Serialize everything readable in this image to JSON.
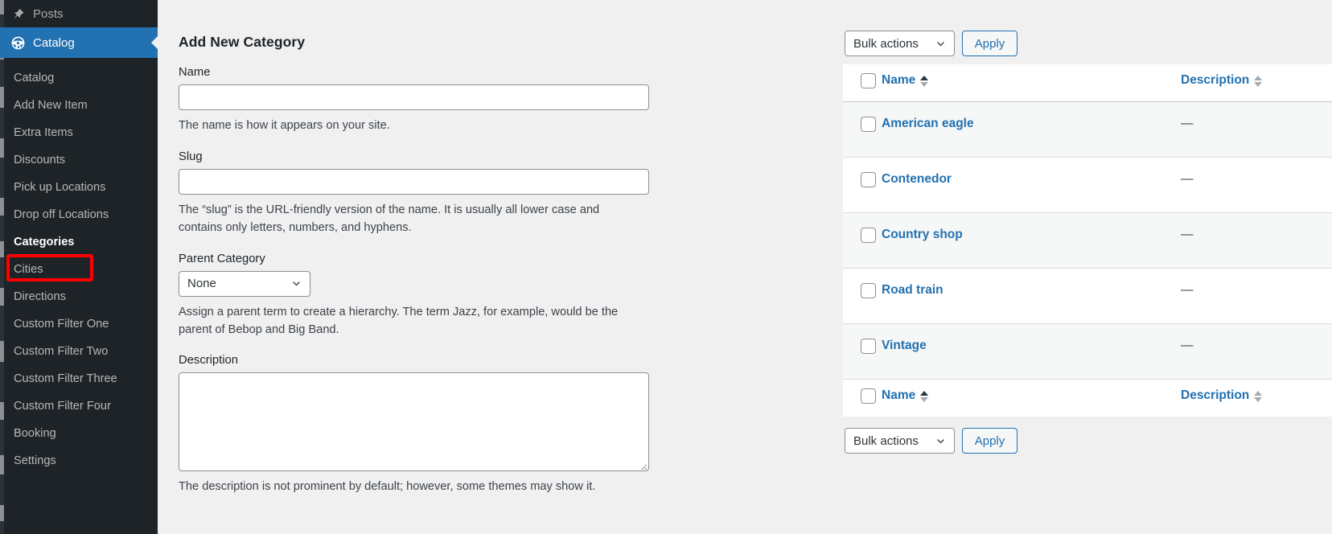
{
  "sidebar": {
    "top_item": {
      "label": "Posts",
      "icon": "pin-icon"
    },
    "current_item": {
      "label": "Catalog",
      "icon": "steering-wheel-icon"
    },
    "submenu": [
      {
        "label": "Catalog",
        "active": false
      },
      {
        "label": "Add New Item",
        "active": false
      },
      {
        "label": "Extra Items",
        "active": false
      },
      {
        "label": "Discounts",
        "active": false
      },
      {
        "label": "Pick up Locations",
        "active": false
      },
      {
        "label": "Drop off Locations",
        "active": false
      },
      {
        "label": "Categories",
        "active": true
      },
      {
        "label": "Cities",
        "active": false
      },
      {
        "label": "Directions",
        "active": false
      },
      {
        "label": "Custom Filter One",
        "active": false
      },
      {
        "label": "Custom Filter Two",
        "active": false
      },
      {
        "label": "Custom Filter Three",
        "active": false
      },
      {
        "label": "Custom Filter Four",
        "active": false
      },
      {
        "label": "Booking",
        "active": false
      },
      {
        "label": "Settings",
        "active": false
      }
    ],
    "highlight_color": "#ff0000",
    "active_bg": "#2271b1",
    "bg": "#1d2327"
  },
  "form": {
    "title": "Add New Category",
    "name": {
      "label": "Name",
      "value": "",
      "placeholder": "",
      "help": "The name is how it appears on your site."
    },
    "slug": {
      "label": "Slug",
      "value": "",
      "placeholder": "",
      "help": "The “slug” is the URL-friendly version of the name. It is usually all lower case and contains only letters, numbers, and hyphens."
    },
    "parent": {
      "label": "Parent Category",
      "selected": "None",
      "options": [
        "None"
      ],
      "help": "Assign a parent term to create a hierarchy. The term Jazz, for example, would be the parent of Bebop and Big Band."
    },
    "description": {
      "label": "Description",
      "value": "",
      "placeholder": "",
      "help": "The description is not prominent by default; however, some themes may show it."
    }
  },
  "table": {
    "bulk_actions_top": {
      "selected": "Bulk actions",
      "apply_label": "Apply"
    },
    "bulk_actions_bottom": {
      "selected": "Bulk actions",
      "apply_label": "Apply"
    },
    "columns": [
      {
        "key": "name",
        "label": "Name",
        "sortable": true,
        "sort_state": "asc-available"
      },
      {
        "key": "description",
        "label": "Description",
        "sortable": true,
        "sort_state": "none"
      }
    ],
    "rows": [
      {
        "name": "American eagle",
        "description": "—"
      },
      {
        "name": "Contenedor",
        "description": "—"
      },
      {
        "name": "Country shop",
        "description": "—"
      },
      {
        "name": "Road train",
        "description": "—"
      },
      {
        "name": "Vintage",
        "description": "—"
      }
    ],
    "link_color": "#2271b1"
  }
}
